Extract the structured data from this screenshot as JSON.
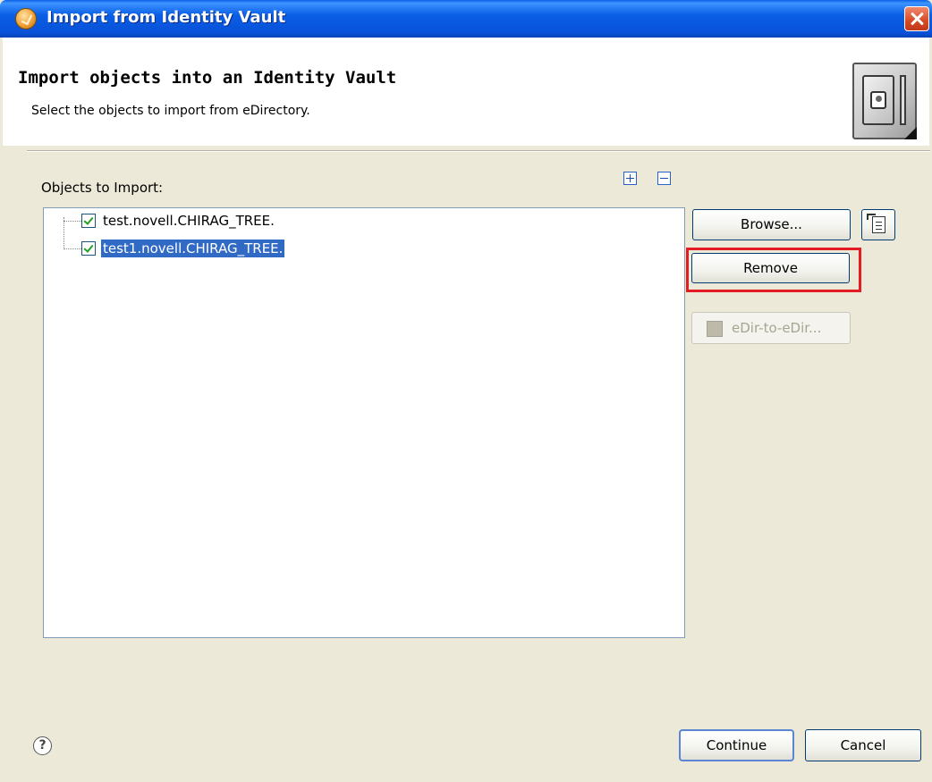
{
  "window": {
    "title": "Import from Identity Vault"
  },
  "header": {
    "title": "Import objects into an Identity Vault",
    "description": "Select the objects to import from eDirectory."
  },
  "objects": {
    "label": "Objects to Import:",
    "items": [
      {
        "label": "test.novell.CHIRAG_TREE.",
        "checked": true,
        "selected": false
      },
      {
        "label": "test1.novell.CHIRAG_TREE.",
        "checked": true,
        "selected": true
      }
    ]
  },
  "actions": {
    "browse_label": "Browse...",
    "remove_label": "Remove",
    "edir_label": "eDir-to-eDir...",
    "edir_enabled": false,
    "remove_highlight_color": "#e31b23"
  },
  "footer": {
    "help_glyph": "?",
    "continue_label": "Continue",
    "cancel_label": "Cancel"
  },
  "icons": {
    "app": "identity-vault-app-icon",
    "close": "close-icon",
    "vault": "vault-icon",
    "expand_all": "expand-all-icon",
    "collapse_all": "collapse-all-icon",
    "import_file": "import-file-icon",
    "edir": "edir-icon",
    "help": "help-icon"
  }
}
